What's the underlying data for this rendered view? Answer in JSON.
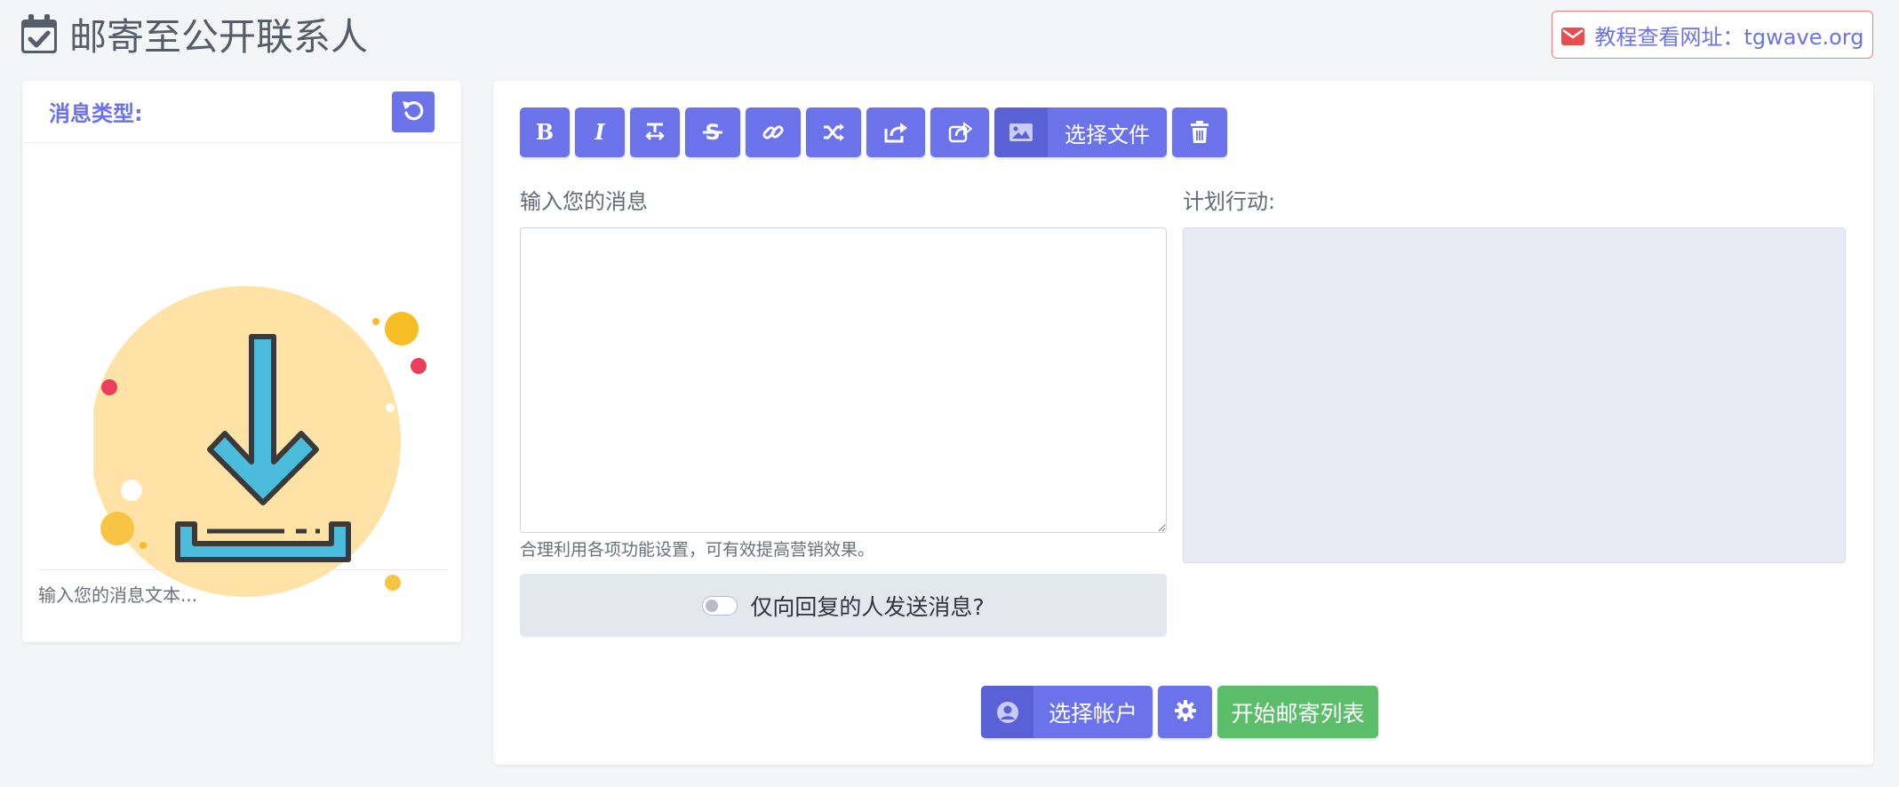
{
  "header": {
    "title": "邮寄至公开联系人",
    "title_icon": "calendar-check-icon",
    "tutorial_link": "教程查看网址：tgwave.org"
  },
  "left_panel": {
    "label": "消息类型:",
    "reset_icon": "undo-icon",
    "illustration": "download-illustration",
    "preview_text": "输入您的消息文本..."
  },
  "toolbar": {
    "buttons": [
      {
        "name": "bold",
        "icon": "bold-icon"
      },
      {
        "name": "italic",
        "icon": "italic-icon"
      },
      {
        "name": "text-height",
        "icon": "text-height-icon"
      },
      {
        "name": "strikethrough",
        "icon": "strikethrough-icon"
      },
      {
        "name": "link",
        "icon": "link-icon"
      },
      {
        "name": "random",
        "icon": "shuffle-icon"
      },
      {
        "name": "share",
        "icon": "share-icon"
      },
      {
        "name": "share-alt",
        "icon": "share-square-icon"
      },
      {
        "name": "delete",
        "icon": "trash-icon"
      }
    ],
    "file_label": "选择文件"
  },
  "message": {
    "label": "输入您的消息",
    "value": "",
    "hint": "合理利用各项功能设置，可有效提高营销效果。"
  },
  "plan": {
    "label": "计划行动:"
  },
  "reply_only": {
    "label": "仅向回复的人发送消息?",
    "checked": false
  },
  "actions": {
    "select_account": "选择帐户",
    "start": "开始邮寄列表"
  },
  "colors": {
    "primary": "#6b72ea",
    "primary_dark": "#5a61d6",
    "success": "#5cbd6b",
    "link_border": "#f27b7b",
    "background": "#f4f5f7"
  }
}
